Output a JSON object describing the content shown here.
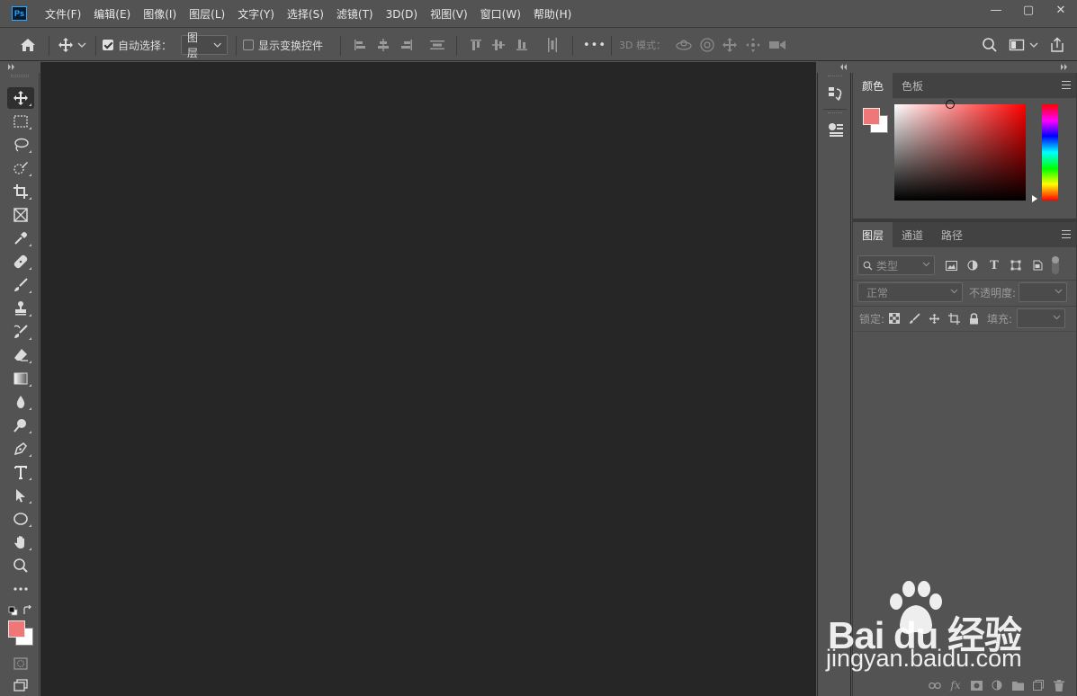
{
  "app": {
    "logo_text": "Ps"
  },
  "menu": [
    "文件(F)",
    "编辑(E)",
    "图像(I)",
    "图层(L)",
    "文字(Y)",
    "选择(S)",
    "滤镜(T)",
    "3D(D)",
    "视图(V)",
    "窗口(W)",
    "帮助(H)"
  ],
  "window_controls": {
    "minimize": "—",
    "restore": "▢",
    "close": "✕"
  },
  "options": {
    "auto_select_label": "自动选择：",
    "auto_select_checked": true,
    "auto_select_target": "图层",
    "show_transform_label": "显示变换控件",
    "show_transform_checked": false,
    "more_label": "•••",
    "mode_3d_label": "3D 模式："
  },
  "tools": [
    {
      "name": "move-tool",
      "active": true
    },
    {
      "name": "marquee-tool"
    },
    {
      "name": "lasso-tool"
    },
    {
      "name": "quick-selection-tool"
    },
    {
      "name": "crop-tool"
    },
    {
      "name": "frame-tool"
    },
    {
      "name": "eyedropper-tool"
    },
    {
      "name": "healing-brush-tool"
    },
    {
      "name": "brush-tool"
    },
    {
      "name": "clone-stamp-tool"
    },
    {
      "name": "history-brush-tool"
    },
    {
      "name": "eraser-tool"
    },
    {
      "name": "gradient-tool"
    },
    {
      "name": "blur-tool"
    },
    {
      "name": "dodge-tool"
    },
    {
      "name": "pen-tool"
    },
    {
      "name": "type-tool"
    },
    {
      "name": "path-selection-tool"
    },
    {
      "name": "ellipse-tool"
    },
    {
      "name": "hand-tool"
    },
    {
      "name": "zoom-tool"
    },
    {
      "name": "edit-toolbar"
    }
  ],
  "colors": {
    "foreground": "#f07777",
    "background": "#ffffff",
    "canvas": "#262626",
    "ui": "#535353"
  },
  "color_panel": {
    "tabs": [
      "颜色",
      "色板"
    ],
    "active_tab": 0
  },
  "layers_panel": {
    "tabs": [
      "图层",
      "通道",
      "路径"
    ],
    "active_tab": 0,
    "filter_label": "类型",
    "blend_mode": "正常",
    "opacity_label": "不透明度:",
    "lock_label": "锁定:",
    "fill_label": "填充:"
  },
  "watermark": {
    "brand": "Bai du 经验",
    "url": "jingyan.baidu.com"
  }
}
